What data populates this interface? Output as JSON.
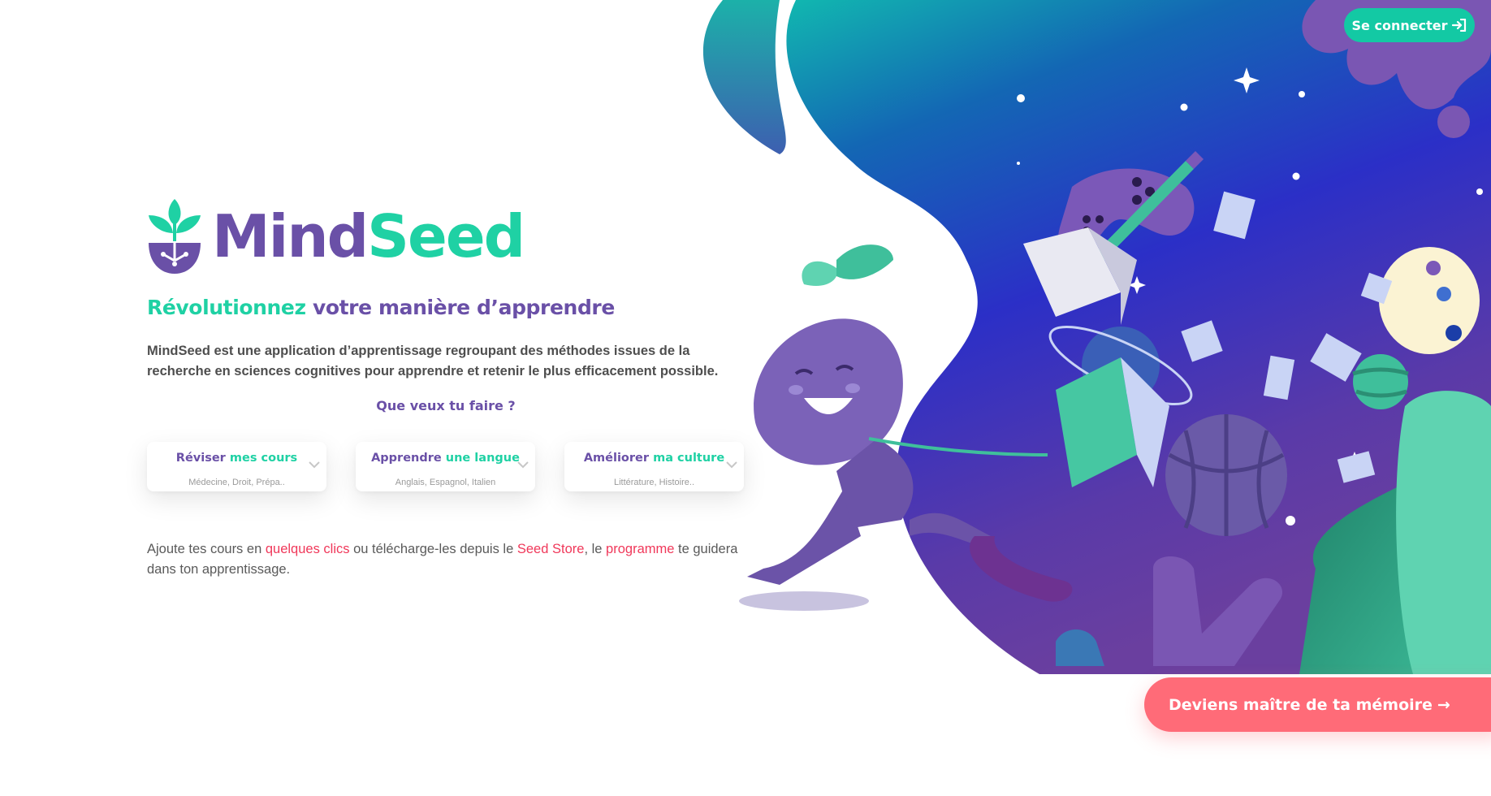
{
  "brand": {
    "name_part1": "Mind",
    "name_part2": "Seed"
  },
  "tagline": {
    "accent": "Révolutionnez",
    "rest": " votre manière d’apprendre"
  },
  "intro": "MindSeed est une application d’apprentissage regroupant des méthodes issues de la recherche en sciences cognitives pour apprendre et retenir le plus efficacement possible.",
  "question": "Que veux tu faire ?",
  "choices": [
    {
      "title": "Réviser",
      "accent": "mes cours",
      "subtitle": "Médecine, Droit, Prépa.."
    },
    {
      "title": "Apprendre",
      "accent": "une langue",
      "subtitle": "Anglais, Espagnol, Italien"
    },
    {
      "title": "Améliorer",
      "accent": "ma culture",
      "subtitle": "Littérature, Histoire.."
    }
  ],
  "footer": {
    "part1": "Ajoute tes cours en ",
    "link1": "quelques clics",
    "part2": " ou télécharge-les depuis le ",
    "link2": "Seed Store",
    "part3": ", le ",
    "link3": "programme",
    "part4": " te guidera dans ton apprentissage."
  },
  "login": {
    "label": "Se connecter",
    "icon": "sign-in-icon"
  },
  "cta": {
    "label": "Deviens maître de ta mémoire",
    "arrow": "→"
  },
  "colors": {
    "purple": "#6a50a7",
    "teal": "#1fd1a4",
    "pink_link": "#f0385a",
    "cta": "#ff6b78",
    "login": "#13c9a4"
  }
}
